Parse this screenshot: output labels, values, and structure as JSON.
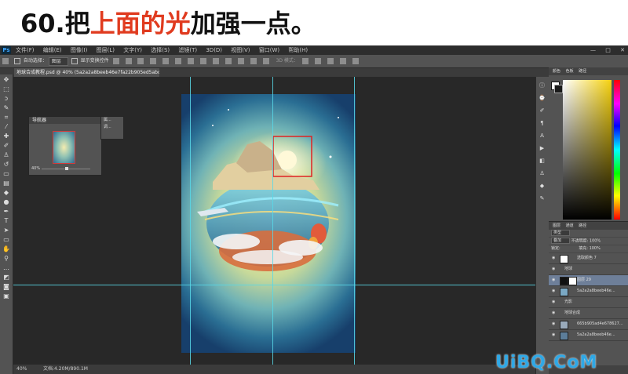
{
  "heading": {
    "prefix": "60.把",
    "highlight": "上面的光",
    "suffix": "加强一点。",
    "prefix_color": "#111111",
    "highlight_color": "#e03b1f"
  },
  "menu": {
    "logo": "Ps",
    "items": [
      "文件(F)",
      "编辑(E)",
      "图像(I)",
      "图层(L)",
      "文字(Y)",
      "选择(S)",
      "滤镜(T)",
      "3D(D)",
      "视图(V)",
      "窗口(W)",
      "帮助(H)"
    ],
    "window_controls": [
      "—",
      "□",
      "✕"
    ]
  },
  "options": {
    "auto_select_label": "自动选择：",
    "auto_select_value": "图层",
    "show_transform_label": "显示变换控件",
    "mode_3d": "3D 模式："
  },
  "document": {
    "tab_title": "地球合成教程.psd @ 40% (5a2a2a8beeb46e7fa22b905ed5abca37, RGB/8) *",
    "zoom": "40%",
    "doc_size": "文档:4.20M/890.1M"
  },
  "navigator": {
    "title": "导航器",
    "zoom": "40%"
  },
  "small_panel": {
    "items": [
      "属...",
      "调..."
    ]
  },
  "color_panel": {
    "tabs": [
      "颜色",
      "色板",
      "路径"
    ],
    "hue_color": "#f5d10f"
  },
  "layers_panel": {
    "tabs": [
      "图层",
      "通道",
      "路径"
    ],
    "kind_label": "类型",
    "blend_mode": "叠加",
    "opacity_label": "不透明度:",
    "opacity_value": "100%",
    "lock_label": "锁定:",
    "fill_label": "填充:",
    "fill_value": "100%",
    "layers": [
      {
        "name": "选取颜色 7",
        "active": false
      },
      {
        "name": "地球",
        "active": false
      },
      {
        "name": "图层 29",
        "active": true
      },
      {
        "name": "5a2a2a8beeb46e...",
        "active": false
      },
      {
        "name": "光影",
        "active": false
      },
      {
        "name": "地球合成",
        "active": false
      },
      {
        "name": "665b905ad4e678627...",
        "active": false
      },
      {
        "name": "5a2a2a8beeb46e...",
        "active": false
      }
    ]
  },
  "watermark": "UiBQ.CoM"
}
